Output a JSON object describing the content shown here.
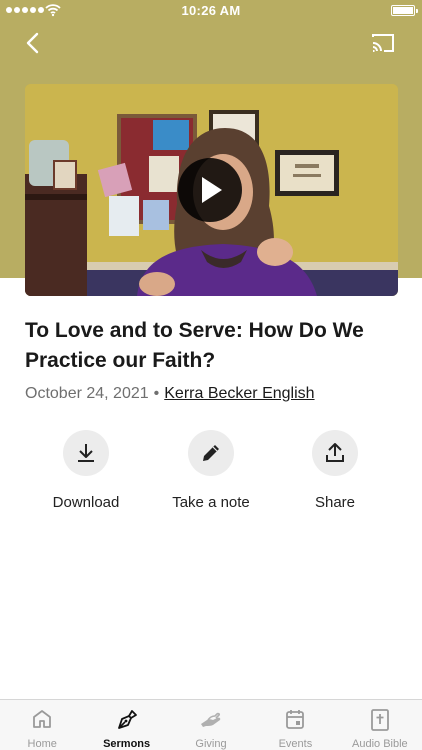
{
  "status_bar": {
    "time": "10:26 AM"
  },
  "nav": {
    "back_icon": "chevron-left-icon",
    "cast_icon": "cast-icon"
  },
  "video": {
    "play_icon": "play-icon"
  },
  "sermon": {
    "title": "To Love and to Serve: How Do We Practice our Faith?",
    "date": "October 24, 2021",
    "separator": "•",
    "speaker": "Kerra Becker English"
  },
  "actions": [
    {
      "label": "Download",
      "icon": "download-icon"
    },
    {
      "label": "Take a note",
      "icon": "pencil-icon"
    },
    {
      "label": "Share",
      "icon": "share-icon"
    }
  ],
  "tabs": [
    {
      "label": "Home",
      "icon": "home-icon",
      "active": false
    },
    {
      "label": "Sermons",
      "icon": "pen-nib-icon",
      "active": true
    },
    {
      "label": "Giving",
      "icon": "giving-hand-icon",
      "active": false
    },
    {
      "label": "Events",
      "icon": "calendar-icon",
      "active": false
    },
    {
      "label": "Audio Bible",
      "icon": "bible-icon",
      "active": false
    }
  ],
  "colors": {
    "hero_background": "#b8ad62",
    "active_tab": "#111111",
    "inactive_tab": "#9a9a9a"
  }
}
